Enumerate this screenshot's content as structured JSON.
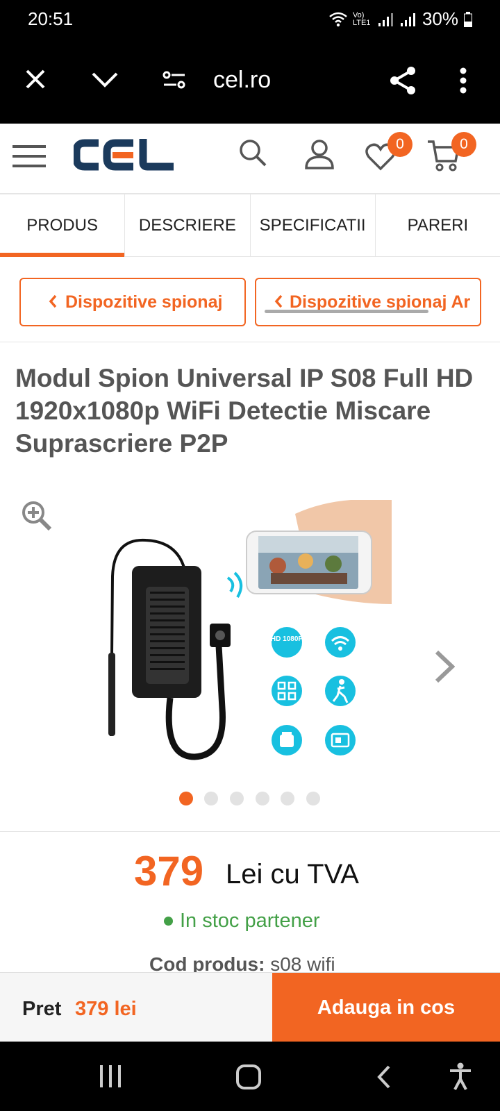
{
  "status": {
    "time": "20:51",
    "network": "Vo) LTE1",
    "battery": "30%"
  },
  "browser": {
    "url": "cel.ro"
  },
  "header": {
    "logo": "CEL",
    "wishlist_count": "0",
    "cart_count": "0"
  },
  "tabs": [
    {
      "label": "PRODUS"
    },
    {
      "label": "DESCRIERE"
    },
    {
      "label": "SPECIFICATII"
    },
    {
      "label": "PARERI"
    }
  ],
  "breadcrumbs": [
    {
      "label": "Dispozitive spionaj"
    },
    {
      "label": "Dispozitive spionaj Ar"
    }
  ],
  "product": {
    "title": "Modul Spion Universal IP S08 Full HD 1920x1080p WiFi Detectie Miscare Suprascriere P2P",
    "image_count": 6,
    "active_image": 1,
    "image_badges": [
      "HD 1080P"
    ],
    "price": "379",
    "price_unit": "Lei cu TVA",
    "stock": "In stoc partener",
    "sku_label": "Cod produs:",
    "sku_value": "s08 wifi"
  },
  "bottom_bar": {
    "pret_label": "Pret",
    "pret_value": "379 lei",
    "add_to_cart": "Adauga in cos"
  },
  "colors": {
    "accent": "#f26522",
    "stock_green": "#43a047",
    "logo_blue": "#1b3a5c"
  }
}
